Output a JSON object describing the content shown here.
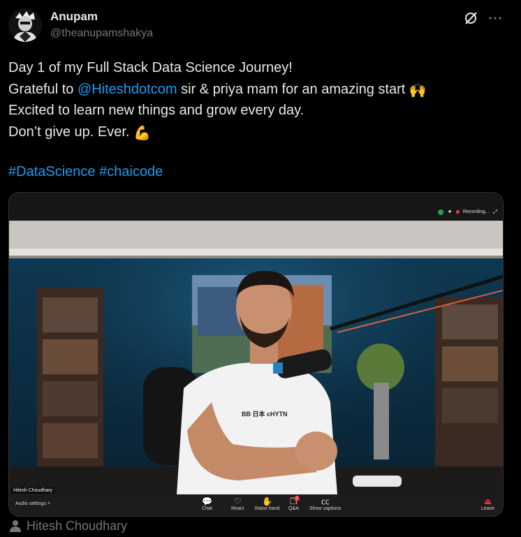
{
  "author": {
    "name": "Anupam",
    "handle": "@theanupamshakya"
  },
  "tweet": {
    "line1": "Day 1 of my Full Stack Data Science Journey!",
    "line2_pre": "Grateful to ",
    "line2_mention": "@Hiteshdotcom",
    "line2_post": " sir & priya mam for an amazing start ",
    "line2_emoji": "🙌",
    "line3": "Excited to learn new things and grow every day.",
    "line4": "Don’t give up. Ever. ",
    "line4_emoji": "💪",
    "hashtag1": "#DataScience",
    "hashtag2": "#chaicode"
  },
  "media": {
    "recording_label": "Recording...",
    "speaker_label": "Hitesh Choudhary",
    "shirt_text": "BB 日本 cHYTN",
    "toolbar": {
      "audio_settings": "Audio settings",
      "chat": "Chat",
      "react": "React",
      "raise_hand": "Raise hand",
      "qa": "Q&A",
      "qa_badge": "2",
      "captions": "Show captions",
      "leave": "Leave"
    }
  },
  "tagged_person": "Hitesh Choudhary"
}
